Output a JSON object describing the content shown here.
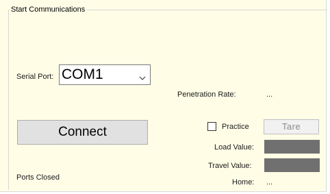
{
  "group": {
    "title": "Start Communications"
  },
  "serial_port": {
    "label": "Serial Port:",
    "value": "COM1"
  },
  "penetration_rate": {
    "label": "Penetration Rate:",
    "value": "..."
  },
  "connect": {
    "label": "Connect"
  },
  "practice": {
    "label": "Practice",
    "checked": false
  },
  "tare": {
    "label": "Tare"
  },
  "load_value": {
    "label": "Load Value:"
  },
  "travel_value": {
    "label": "Travel Value:"
  },
  "home": {
    "label": "Home:",
    "value": "..."
  },
  "status": {
    "text": "Ports Closed"
  },
  "colors": {
    "panel_background": "#fffde6",
    "value_box": "#707070"
  }
}
